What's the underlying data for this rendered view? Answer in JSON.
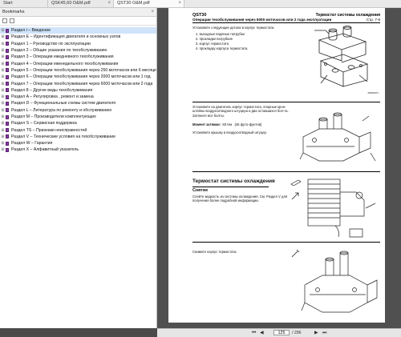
{
  "tabs": [
    {
      "label": "Start"
    },
    {
      "label": "QSK45,60 O&M.pdf"
    },
    {
      "label": "QST30 O&M.pdf"
    }
  ],
  "bookmarks": {
    "title": "Bookmarks",
    "items": [
      {
        "label": "Раздел i – Введение"
      },
      {
        "label": "Раздел E – Идентификация двигателя и основных узлов"
      },
      {
        "label": "Раздел 1 – Руководство по эксплуатации"
      },
      {
        "label": "Раздел 2 – Общие указания по техобслуживанию"
      },
      {
        "label": "Раздел 3 – Операции ежедневного техобслуживания"
      },
      {
        "label": "Раздел 4 – Операции еженедельного техобслуживания"
      },
      {
        "label": "Раздел 5 – Операции техобслуживания через 250 моточасов или 6 месяцев"
      },
      {
        "label": "Раздел 6 – Операции техобслуживания через 2000 моточасов или 1 год"
      },
      {
        "label": "Раздел 7 – Операции техобслуживания через 6000 моточасов или 2 года"
      },
      {
        "label": "Раздел 8 – Другие виды техобслуживания"
      },
      {
        "label": "Раздел A – Регулировка , ремонт и замена"
      },
      {
        "label": "Раздел D – Функциональные схемы систем двигателя"
      },
      {
        "label": "Раздел L – Литература по ремонту и обслуживанию"
      },
      {
        "label": "Раздел M – Производители комплектующих"
      },
      {
        "label": "Раздел S – Сервисная поддержка"
      },
      {
        "label": "Раздел TS – Признаки неисправностей"
      },
      {
        "label": "Раздел V – Технические условия на техобслуживание"
      },
      {
        "label": "Раздел W – Гарантия"
      },
      {
        "label": "Раздел X – Алфавитный указатель"
      }
    ]
  },
  "page": {
    "header_left": "QST30",
    "header_left_sub": "Операции техобслуживания через 6000 моточасов или 2 года эксплуатации",
    "header_right": "Термостат системы охлаждения",
    "header_right_sub": "Стр. 7-5",
    "install_intro": "Установите следующие детали в корпус термостата.",
    "install_steps": [
      "1. выходные водяные патрубки",
      "2. прокладки патрубков",
      "3. корпус термостата",
      "4. прокладку корпуса термостата."
    ],
    "fig1_code": "06b00071",
    "install_text": "Установите на двигатель корпус термостата, опорные крон-штейны воздухоотводного штуцера и два оставшихся бол-та. Затяните все болты.",
    "torque_label": "Момент затяжки:",
    "torque_value": "60 Нм",
    "torque_alt": "[45 футо-фунтов]",
    "cover_text": "Установите крышку и воздухоотводный штуцер.",
    "section_title": "Термостат системы охлаждения",
    "removal_title": "Снятие",
    "removal_text": "Слейте жидкость из системы охлаждения. См. Раздел V для получения более подробной информации.",
    "remove_housing_text": "Снимите корпус термостата."
  },
  "nav": {
    "current_page": "125",
    "total_pages": "/ 296"
  }
}
